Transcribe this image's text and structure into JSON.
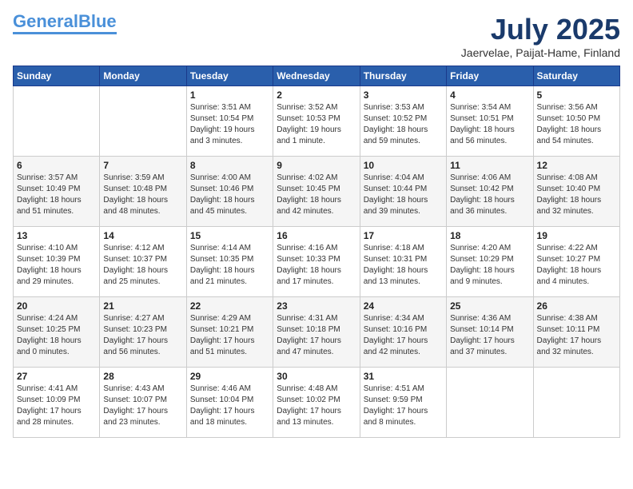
{
  "logo": {
    "part1": "General",
    "part2": "Blue"
  },
  "title": "July 2025",
  "subtitle": "Jaervelae, Paijat-Hame, Finland",
  "days_of_week": [
    "Sunday",
    "Monday",
    "Tuesday",
    "Wednesday",
    "Thursday",
    "Friday",
    "Saturday"
  ],
  "weeks": [
    [
      {
        "day": "",
        "info": ""
      },
      {
        "day": "",
        "info": ""
      },
      {
        "day": "1",
        "info": "Sunrise: 3:51 AM\nSunset: 10:54 PM\nDaylight: 19 hours\nand 3 minutes."
      },
      {
        "day": "2",
        "info": "Sunrise: 3:52 AM\nSunset: 10:53 PM\nDaylight: 19 hours\nand 1 minute."
      },
      {
        "day": "3",
        "info": "Sunrise: 3:53 AM\nSunset: 10:52 PM\nDaylight: 18 hours\nand 59 minutes."
      },
      {
        "day": "4",
        "info": "Sunrise: 3:54 AM\nSunset: 10:51 PM\nDaylight: 18 hours\nand 56 minutes."
      },
      {
        "day": "5",
        "info": "Sunrise: 3:56 AM\nSunset: 10:50 PM\nDaylight: 18 hours\nand 54 minutes."
      }
    ],
    [
      {
        "day": "6",
        "info": "Sunrise: 3:57 AM\nSunset: 10:49 PM\nDaylight: 18 hours\nand 51 minutes."
      },
      {
        "day": "7",
        "info": "Sunrise: 3:59 AM\nSunset: 10:48 PM\nDaylight: 18 hours\nand 48 minutes."
      },
      {
        "day": "8",
        "info": "Sunrise: 4:00 AM\nSunset: 10:46 PM\nDaylight: 18 hours\nand 45 minutes."
      },
      {
        "day": "9",
        "info": "Sunrise: 4:02 AM\nSunset: 10:45 PM\nDaylight: 18 hours\nand 42 minutes."
      },
      {
        "day": "10",
        "info": "Sunrise: 4:04 AM\nSunset: 10:44 PM\nDaylight: 18 hours\nand 39 minutes."
      },
      {
        "day": "11",
        "info": "Sunrise: 4:06 AM\nSunset: 10:42 PM\nDaylight: 18 hours\nand 36 minutes."
      },
      {
        "day": "12",
        "info": "Sunrise: 4:08 AM\nSunset: 10:40 PM\nDaylight: 18 hours\nand 32 minutes."
      }
    ],
    [
      {
        "day": "13",
        "info": "Sunrise: 4:10 AM\nSunset: 10:39 PM\nDaylight: 18 hours\nand 29 minutes."
      },
      {
        "day": "14",
        "info": "Sunrise: 4:12 AM\nSunset: 10:37 PM\nDaylight: 18 hours\nand 25 minutes."
      },
      {
        "day": "15",
        "info": "Sunrise: 4:14 AM\nSunset: 10:35 PM\nDaylight: 18 hours\nand 21 minutes."
      },
      {
        "day": "16",
        "info": "Sunrise: 4:16 AM\nSunset: 10:33 PM\nDaylight: 18 hours\nand 17 minutes."
      },
      {
        "day": "17",
        "info": "Sunrise: 4:18 AM\nSunset: 10:31 PM\nDaylight: 18 hours\nand 13 minutes."
      },
      {
        "day": "18",
        "info": "Sunrise: 4:20 AM\nSunset: 10:29 PM\nDaylight: 18 hours\nand 9 minutes."
      },
      {
        "day": "19",
        "info": "Sunrise: 4:22 AM\nSunset: 10:27 PM\nDaylight: 18 hours\nand 4 minutes."
      }
    ],
    [
      {
        "day": "20",
        "info": "Sunrise: 4:24 AM\nSunset: 10:25 PM\nDaylight: 18 hours\nand 0 minutes."
      },
      {
        "day": "21",
        "info": "Sunrise: 4:27 AM\nSunset: 10:23 PM\nDaylight: 17 hours\nand 56 minutes."
      },
      {
        "day": "22",
        "info": "Sunrise: 4:29 AM\nSunset: 10:21 PM\nDaylight: 17 hours\nand 51 minutes."
      },
      {
        "day": "23",
        "info": "Sunrise: 4:31 AM\nSunset: 10:18 PM\nDaylight: 17 hours\nand 47 minutes."
      },
      {
        "day": "24",
        "info": "Sunrise: 4:34 AM\nSunset: 10:16 PM\nDaylight: 17 hours\nand 42 minutes."
      },
      {
        "day": "25",
        "info": "Sunrise: 4:36 AM\nSunset: 10:14 PM\nDaylight: 17 hours\nand 37 minutes."
      },
      {
        "day": "26",
        "info": "Sunrise: 4:38 AM\nSunset: 10:11 PM\nDaylight: 17 hours\nand 32 minutes."
      }
    ],
    [
      {
        "day": "27",
        "info": "Sunrise: 4:41 AM\nSunset: 10:09 PM\nDaylight: 17 hours\nand 28 minutes."
      },
      {
        "day": "28",
        "info": "Sunrise: 4:43 AM\nSunset: 10:07 PM\nDaylight: 17 hours\nand 23 minutes."
      },
      {
        "day": "29",
        "info": "Sunrise: 4:46 AM\nSunset: 10:04 PM\nDaylight: 17 hours\nand 18 minutes."
      },
      {
        "day": "30",
        "info": "Sunrise: 4:48 AM\nSunset: 10:02 PM\nDaylight: 17 hours\nand 13 minutes."
      },
      {
        "day": "31",
        "info": "Sunrise: 4:51 AM\nSunset: 9:59 PM\nDaylight: 17 hours\nand 8 minutes."
      },
      {
        "day": "",
        "info": ""
      },
      {
        "day": "",
        "info": ""
      }
    ]
  ]
}
